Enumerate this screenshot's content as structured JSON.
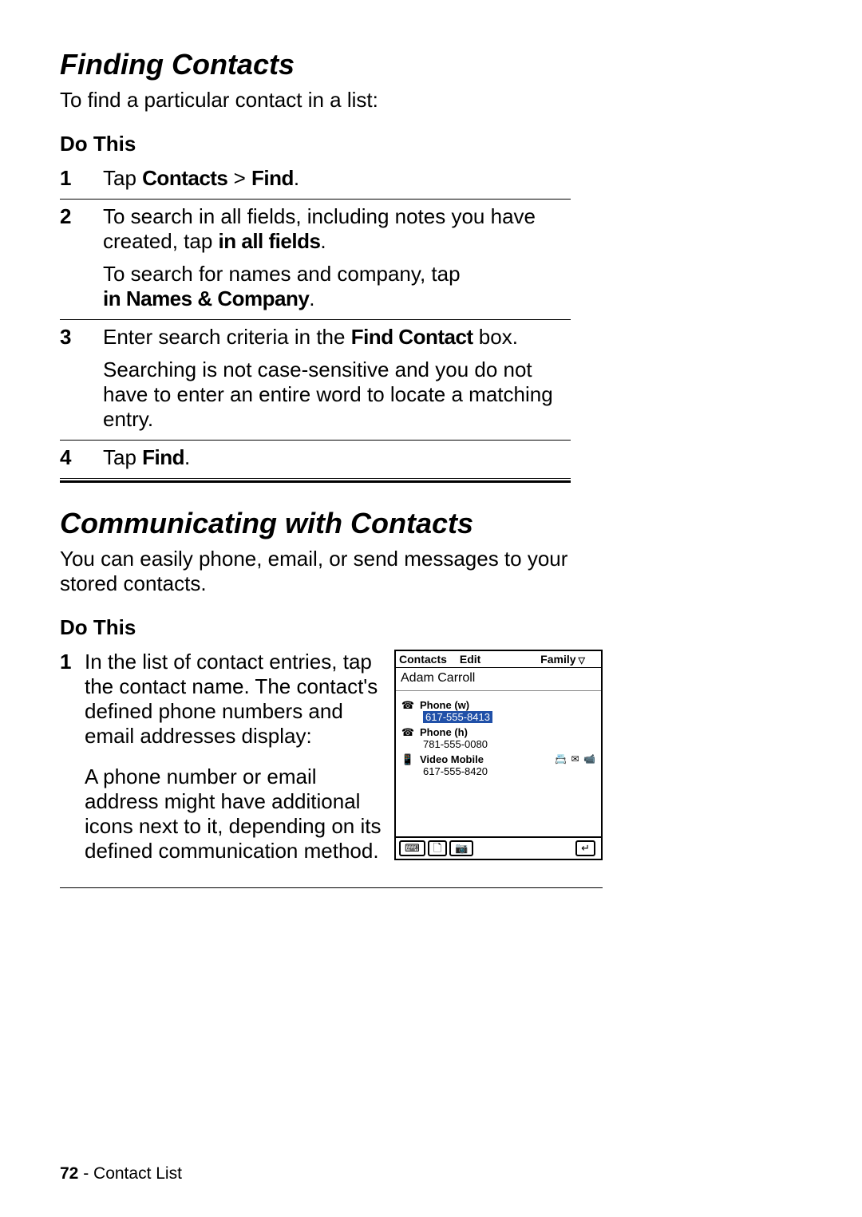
{
  "section1": {
    "heading": "Finding Contacts",
    "intro": "To find a particular contact in a list:",
    "dothis": "Do This",
    "steps": {
      "s1_num": "1",
      "s1_a": "Tap ",
      "s1_b": "Contacts",
      "s1_c": " > ",
      "s1_d": "Find",
      "s1_e": ".",
      "s2_num": "2",
      "s2_a": "To search in all fields, including notes you have created, tap ",
      "s2_b": "in all fields",
      "s2_c": ".",
      "s2_d": "To search for names and company, tap",
      "s2_e": "in Names & Company",
      "s2_f": ".",
      "s3_num": "3",
      "s3_a": "Enter search criteria in the ",
      "s3_b": "Find Contact",
      "s3_c": " box.",
      "s3_d": "Searching is not case-sensitive and you do not have to enter an entire word to locate a matching entry.",
      "s4_num": "4",
      "s4_a": "Tap ",
      "s4_b": "Find",
      "s4_c": "."
    }
  },
  "section2": {
    "heading": "Communicating with Contacts",
    "intro": "You can easily phone, email, or send messages to your stored contacts.",
    "dothis": "Do This",
    "step1_num": "1",
    "step1_a": "In the list of contact entries, tap the contact name. The contact's defined phone numbers and email addresses display:",
    "step1_b": "A phone number or email address might have additional icons next to it, depending on its defined communication method."
  },
  "screenshot": {
    "menu_contacts": "Contacts",
    "menu_edit": "Edit",
    "menu_family": "Family",
    "contact_name": "Adam Carroll",
    "row1_label": "Phone (w)",
    "row1_number": "617-555-8413",
    "row2_label": "Phone (h)",
    "row2_number": "781-555-0080",
    "row3_label": "Video Mobile",
    "row3_number": "617-555-8420",
    "phone_glyph": "☎",
    "video_glyph": "📱",
    "ricon1": "📇",
    "ricon2": "✉",
    "ricon3": "📹",
    "tb1": "⌨",
    "tb2": "🗋",
    "tb3": "📷",
    "tb4": "↵"
  },
  "footer": {
    "page": "72",
    "sep": " - ",
    "title": "Contact List"
  }
}
